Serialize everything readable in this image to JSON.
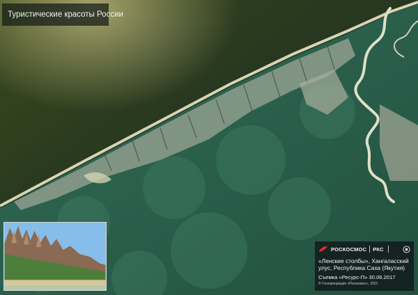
{
  "header": {
    "title": "Туристические красоты России"
  },
  "caption": {
    "logo_roscosmos": "РОСКОСМОС",
    "logo_rks": "РКС",
    "place_line1": "«Ленские столбы», Хангаласский",
    "place_line2": "улус, Республика Саха (Якутия)",
    "survey": "Съемка «Ресурс-П» 30.06.2017",
    "credit": "© Госкорпорация «Роскосмос», 2021"
  },
  "inset_photo": {
    "subject": "rock pillars above river"
  },
  "scene": {
    "subject": "satellite image of river bank with forest and cliffs",
    "colors": {
      "river": "#2b3a20",
      "forest": "#3a6b52",
      "bank": "#d8d4b6",
      "cliffs": "#b8b8a4"
    }
  }
}
